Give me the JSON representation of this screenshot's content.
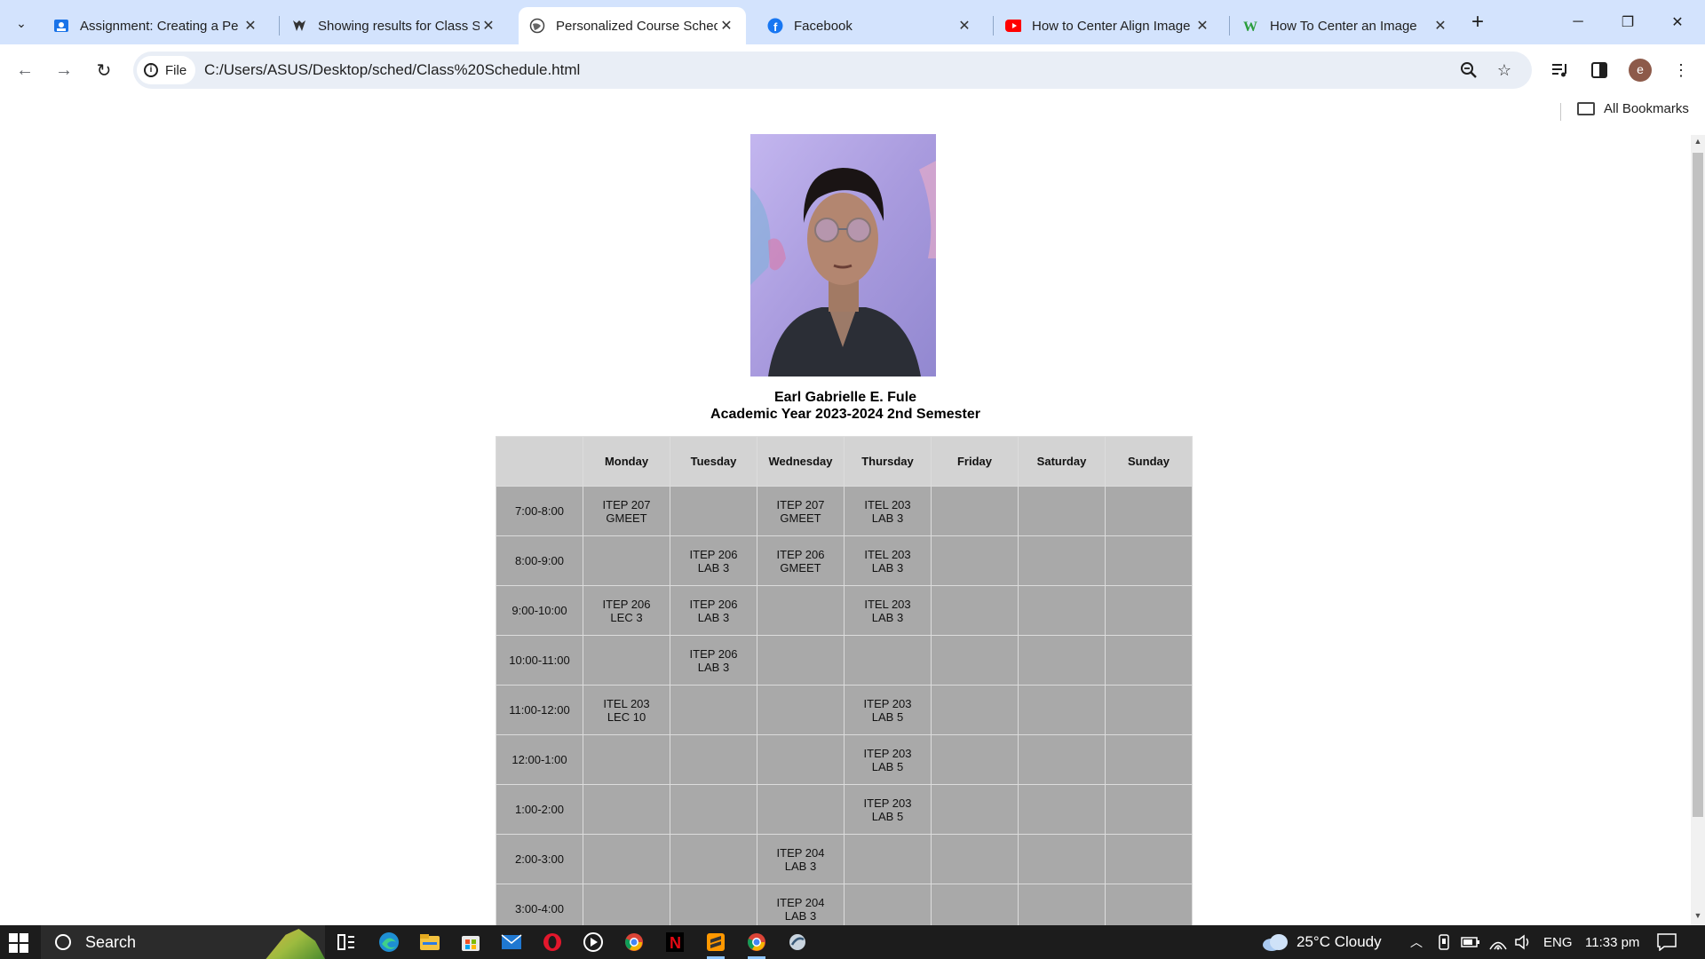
{
  "browser": {
    "tabs": [
      {
        "title": "Assignment: Creating a Pe",
        "icon": "classroom-icon"
      },
      {
        "title": "Showing results for Class S",
        "icon": "search-results-icon"
      },
      {
        "title": "Personalized Course Sched",
        "icon": "globe-icon"
      },
      {
        "title": "Facebook",
        "icon": "facebook-icon"
      },
      {
        "title": "How to Center Align Image",
        "icon": "youtube-icon"
      },
      {
        "title": "How To Center an Image",
        "icon": "wikihow-icon"
      }
    ],
    "active_tab": 2,
    "file_chip": "File",
    "url": "C:/Users/ASUS/Desktop/sched/Class%20Schedule.html",
    "avatar_letter": "e",
    "bookmarks_label": "All Bookmarks"
  },
  "page": {
    "name": "Earl Gabrielle E. Fule",
    "academic_year": "Academic Year 2023-2024 2nd Semester",
    "days": [
      "Monday",
      "Tuesday",
      "Wednesday",
      "Thursday",
      "Friday",
      "Saturday",
      "Sunday"
    ],
    "rows": [
      {
        "time": "7:00-8:00",
        "cells": [
          "ITEP 207|GMEET",
          "",
          "ITEP 207|GMEET",
          "ITEL 203|LAB 3",
          "",
          "",
          ""
        ]
      },
      {
        "time": "8:00-9:00",
        "cells": [
          "",
          "ITEP 206|LAB 3",
          "ITEP 206|GMEET",
          "ITEL 203|LAB 3",
          "",
          "",
          ""
        ]
      },
      {
        "time": "9:00-10:00",
        "cells": [
          "ITEP 206|LEC 3",
          "ITEP 206|LAB 3",
          "",
          "ITEL 203|LAB 3",
          "",
          "",
          ""
        ]
      },
      {
        "time": "10:00-11:00",
        "cells": [
          "",
          "ITEP 206|LAB 3",
          "",
          "",
          "",
          "",
          ""
        ]
      },
      {
        "time": "11:00-12:00",
        "cells": [
          "ITEL 203|LEC 10",
          "",
          "",
          "ITEP 203|LAB 5",
          "",
          "",
          ""
        ]
      },
      {
        "time": "12:00-1:00",
        "cells": [
          "",
          "",
          "",
          "ITEP 203|LAB 5",
          "",
          "",
          ""
        ]
      },
      {
        "time": "1:00-2:00",
        "cells": [
          "",
          "",
          "",
          "ITEP 203|LAB 5",
          "",
          "",
          ""
        ]
      },
      {
        "time": "2:00-3:00",
        "cells": [
          "",
          "",
          "ITEP 204|LAB 3",
          "",
          "",
          "",
          ""
        ]
      },
      {
        "time": "3:00-4:00",
        "cells": [
          "",
          "",
          "ITEP 204|LAB 3",
          "",
          "",
          "",
          ""
        ]
      }
    ]
  },
  "taskbar": {
    "search_label": "Search",
    "weather": "25°C  Cloudy",
    "language": "ENG",
    "time": "11:33 pm"
  }
}
